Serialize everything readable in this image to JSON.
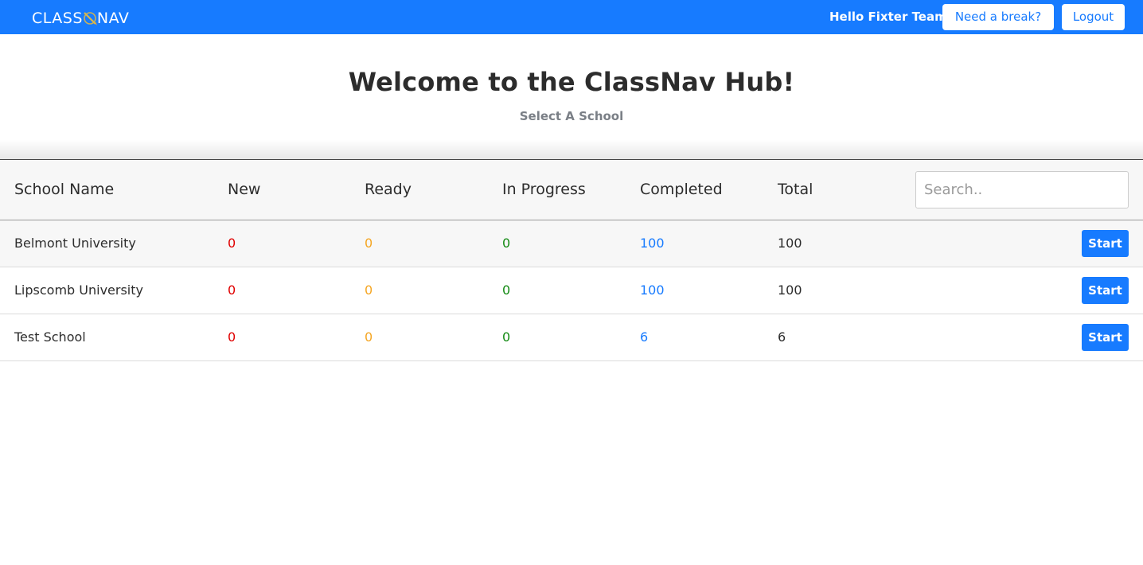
{
  "header": {
    "logo_left": "CLASS",
    "logo_right": "NAV",
    "logo_icon": "compass-pencil-icon",
    "greeting": "Hello Fixter Team",
    "break_button": "Need a break?",
    "logout_button": "Logout"
  },
  "main": {
    "title": "Welcome to the ClassNav Hub!",
    "subtitle": "Select A School"
  },
  "table": {
    "columns": [
      "School Name",
      "New",
      "Ready",
      "In Progress",
      "Completed",
      "Total"
    ],
    "search_placeholder": "Search..",
    "rows": [
      {
        "name": "Belmont University",
        "new": "0",
        "ready": "0",
        "in_progress": "0",
        "completed": "100",
        "total": "100",
        "action": "Start"
      },
      {
        "name": "Lipscomb University",
        "new": "0",
        "ready": "0",
        "in_progress": "0",
        "completed": "100",
        "total": "100",
        "action": "Start"
      },
      {
        "name": "Test School",
        "new": "0",
        "ready": "0",
        "in_progress": "0",
        "completed": "6",
        "total": "6",
        "action": "Start"
      }
    ]
  },
  "colors": {
    "brand": "#177bff",
    "new": "#e00000",
    "ready": "#f5a623",
    "in_progress": "#138a13",
    "completed": "#177bff"
  }
}
